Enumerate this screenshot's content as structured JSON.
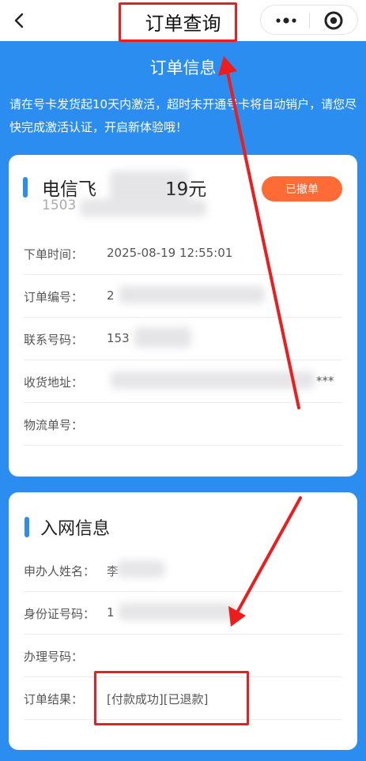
{
  "nav": {
    "title": "订单查询",
    "back_icon": "chevron-left-icon",
    "more_icon": "more-dots-icon",
    "target_icon": "target-icon"
  },
  "header": {
    "title": "订单信息",
    "notice": "请在号卡发货起10天内激活，超时未开通号卡将自动销户，请您尽快完成激活认证，开启新体验哦！"
  },
  "order": {
    "product_name": "电信飞",
    "product_name_tail": "19元",
    "product_sub": "1503",
    "status_label": "已撤单",
    "fields": [
      {
        "label": "下单时间：",
        "value": "2025-08-19 12:55:01"
      },
      {
        "label": "订单编号：",
        "value": "2"
      },
      {
        "label": "联系号码：",
        "value": "153"
      },
      {
        "label": "收货地址：",
        "value": "***"
      },
      {
        "label": "物流单号：",
        "value": ""
      }
    ]
  },
  "network": {
    "title": "入网信息",
    "fields": [
      {
        "label": "申办人姓名：",
        "value": "李"
      },
      {
        "label": "身份证号码：",
        "value": "1"
      },
      {
        "label": "办理号码：",
        "value": ""
      },
      {
        "label": "订单结果：",
        "value": "[付款成功][已退款]"
      }
    ]
  },
  "colors": {
    "accent": "#2c8df1",
    "status_button": "#ff6b35",
    "annotation": "#ee1c1c"
  }
}
